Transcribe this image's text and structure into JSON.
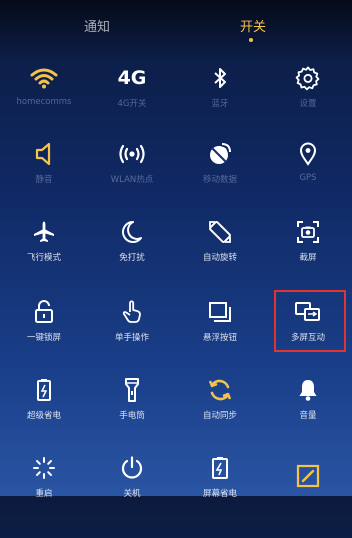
{
  "tabs": [
    {
      "label": "通知"
    },
    {
      "label": "开关"
    }
  ],
  "colors": {
    "accent": "#f3c34a",
    "highlight_box": "#e0342f"
  },
  "tiles": [
    {
      "label": "homecomms",
      "icon": "wifi-icon"
    },
    {
      "label": "4G开关",
      "icon": "4g-icon",
      "glyph": "4G"
    },
    {
      "label": "蓝牙",
      "icon": "bluetooth-icon"
    },
    {
      "label": "设置",
      "icon": "gear-icon"
    },
    {
      "label": "静音",
      "icon": "speaker-icon"
    },
    {
      "label": "WLAN热点",
      "icon": "hotspot-icon"
    },
    {
      "label": "移动数据",
      "icon": "satellite-dish-icon"
    },
    {
      "label": "GPS",
      "icon": "location-pin-icon"
    },
    {
      "label": "飞行模式",
      "icon": "airplane-icon"
    },
    {
      "label": "免打扰",
      "icon": "moon-icon"
    },
    {
      "label": "自动旋转",
      "icon": "rotate-icon"
    },
    {
      "label": "截屏",
      "icon": "screenshot-icon"
    },
    {
      "label": "一键锁屏",
      "icon": "lock-icon"
    },
    {
      "label": "单手操作",
      "icon": "hand-icon"
    },
    {
      "label": "悬浮按钮",
      "icon": "float-button-icon"
    },
    {
      "label": "多屏互动",
      "icon": "multiscreen-icon"
    },
    {
      "label": "超级省电",
      "icon": "battery-saver-icon"
    },
    {
      "label": "手电筒",
      "icon": "flashlight-icon"
    },
    {
      "label": "自动同步",
      "icon": "sync-icon"
    },
    {
      "label": "音量",
      "icon": "bell-icon"
    },
    {
      "label": "重启",
      "icon": "restart-icon"
    },
    {
      "label": "关机",
      "icon": "power-icon"
    },
    {
      "label": "屏幕省电",
      "icon": "screen-saver-icon"
    },
    {
      "label": "",
      "icon": "edit-icon"
    }
  ]
}
